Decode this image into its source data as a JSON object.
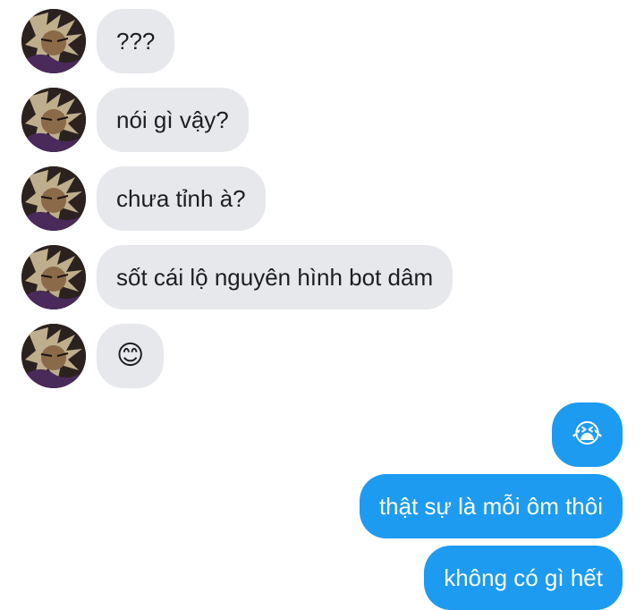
{
  "incoming": [
    {
      "text": "???"
    },
    {
      "text": "nói gì vậy?"
    },
    {
      "text": "chưa tỉnh à?"
    },
    {
      "text": "sốt cái lộ nguyên hình bot dâm"
    },
    {
      "text": "😊"
    }
  ],
  "outgoing": [
    {
      "text": "😭"
    },
    {
      "text": "thật sự là mỗi ôm thôi"
    },
    {
      "text": "không có gì hết"
    }
  ],
  "colors": {
    "incoming_bubble": "#e7e8ec",
    "outgoing_bubble": "#1d9bf0"
  },
  "icons": {
    "avatar": "user-avatar-icon"
  }
}
